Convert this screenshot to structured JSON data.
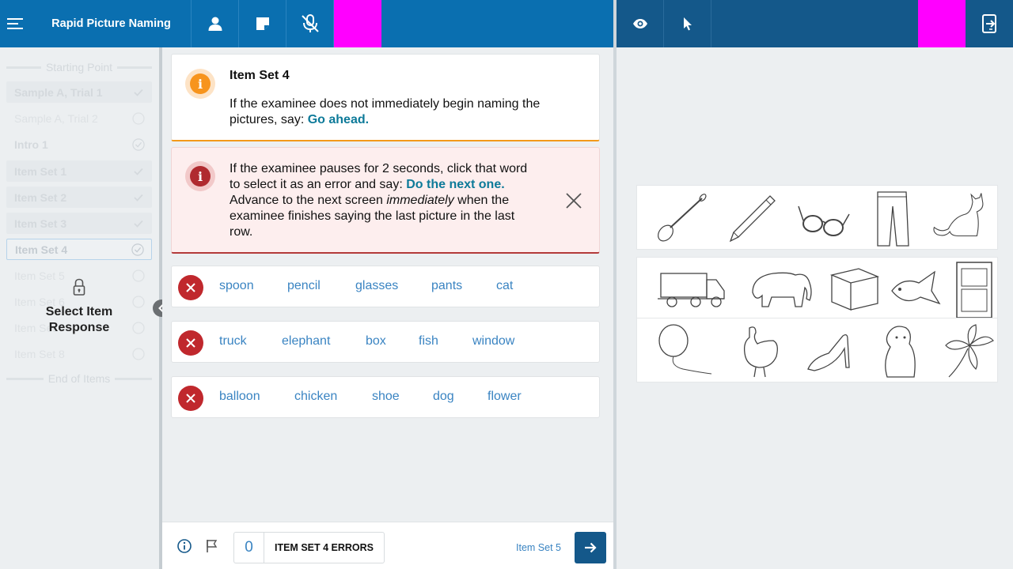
{
  "header": {
    "title": "Rapid Picture Naming",
    "icons": [
      "menu-icon",
      "person-icon",
      "note-icon",
      "mic-off-icon",
      "eye-icon",
      "pointer-icon",
      "exit-icon"
    ]
  },
  "sidebar": {
    "start_separator": "Starting Point",
    "end_separator": "End of Items",
    "items": [
      {
        "label": "Sample A, Trial 1",
        "status": "check"
      },
      {
        "label": "Sample A, Trial 2",
        "status": "circle"
      },
      {
        "label": "Intro 1",
        "status": "check-circle"
      },
      {
        "label": "Item Set 1",
        "status": "check"
      },
      {
        "label": "Item Set 2",
        "status": "check"
      },
      {
        "label": "Item Set 3",
        "status": "check"
      },
      {
        "label": "Item Set 4",
        "status": "check-circle-active"
      },
      {
        "label": "Item Set 5",
        "status": "circle"
      },
      {
        "label": "Item Set 6",
        "status": "circle"
      },
      {
        "label": "Item Set 7",
        "status": "circle"
      },
      {
        "label": "Item Set 8",
        "status": "circle"
      }
    ],
    "lock_label_line1": "Select Item",
    "lock_label_line2": "Response"
  },
  "info_card": {
    "title": "Item Set 4",
    "text_line1": "If the examinee does not immediately begin naming the",
    "text_line2": "pictures, say: ",
    "highlight": "Go ahead."
  },
  "warn_card": {
    "line1": "If the examinee pauses for 2 seconds, click that word",
    "line2_a": "to select it as an error and say: ",
    "line2_hl": "Do the next one.",
    "line3_a": "Advance to the next screen ",
    "line3_em": "immediately",
    "line3_b": " when the",
    "line4": "examinee finishes saying the last picture in the last",
    "line5": "row."
  },
  "rows": [
    [
      "spoon",
      "pencil",
      "glasses",
      "pants",
      "cat"
    ],
    [
      "truck",
      "elephant",
      "box",
      "fish",
      "window"
    ],
    [
      "balloon",
      "chicken",
      "shoe",
      "dog",
      "flower"
    ]
  ],
  "footer": {
    "error_count": "0",
    "error_label": "ITEM SET 4 ERRORS",
    "next_label": "Item Set 5"
  },
  "colors": {
    "topbar": "#0a6fb0",
    "topbar_right": "#14588a",
    "error_red": "#c0282d",
    "link_blue": "#3a84c2",
    "highlight_teal": "#0d7a99",
    "warning_orange": "#f39a1a",
    "magenta": "#ff00ff"
  }
}
